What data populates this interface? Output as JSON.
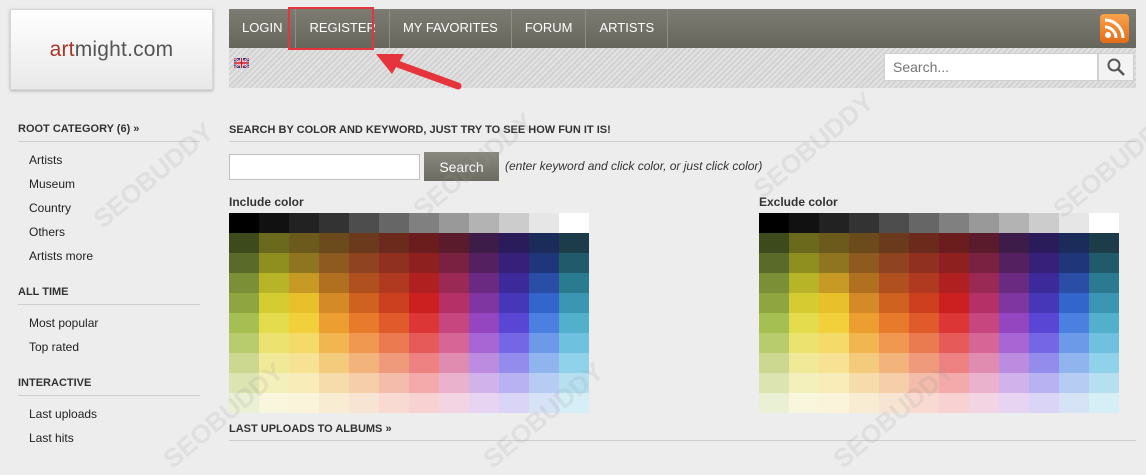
{
  "logo": {
    "part1": "ar",
    "part2": "t",
    "part3": "might.com"
  },
  "nav": {
    "items": [
      "LOGIN",
      "REGISTER",
      "MY FAVORITES",
      "FORUM",
      "ARTISTS"
    ]
  },
  "search": {
    "placeholder": "Search..."
  },
  "sidebar": {
    "sections": [
      {
        "title": "ROOT CATEGORY (6) »",
        "items": [
          "Artists",
          "Museum",
          "Country",
          "Others",
          "Artists more"
        ]
      },
      {
        "title": "ALL TIME",
        "items": [
          "Most popular",
          "Top rated"
        ]
      },
      {
        "title": "INTERACTIVE",
        "items": [
          "Last uploads",
          "Last hits"
        ]
      }
    ]
  },
  "main": {
    "heading": "SEARCH BY COLOR AND KEYWORD, JUST TRY TO SEE HOW FUN IT IS!",
    "search_button": "Search",
    "hint": "(enter keyword and click color, or just click color)",
    "include_label": "Include color",
    "exclude_label": "Exclude color",
    "bottom_heading": "LAST UPLOADS TO ALBUMS »"
  },
  "watermark": "SEOBUDDY",
  "colors": {
    "grays": [
      "#000000",
      "#111111",
      "#222222",
      "#333333",
      "#4d4d4d",
      "#666666",
      "#808080",
      "#999999",
      "#b3b3b3",
      "#cccccc",
      "#e6e6e6",
      "#ffffff"
    ],
    "hues": [
      [
        "#3c4a1c",
        "#6b6a1c",
        "#6b5a1c",
        "#6b4a1c",
        "#6b3a1c",
        "#6b2a1c",
        "#6b1c1c",
        "#5a1c2c",
        "#3e1c4a",
        "#2a1c5a",
        "#1c2c5a",
        "#1c3c4a"
      ],
      [
        "#5a6a28",
        "#8f8f20",
        "#8f7520",
        "#8f5a20",
        "#8f4320",
        "#8f3020",
        "#8f2020",
        "#7a2040",
        "#552060",
        "#36207a",
        "#20367a",
        "#205a6b"
      ],
      [
        "#7a8f36",
        "#b7b428",
        "#c79a26",
        "#b07020",
        "#b05020",
        "#b03a20",
        "#b02020",
        "#9a2a55",
        "#6a2a82",
        "#3c2a9a",
        "#2a4ea6",
        "#2a7a90"
      ],
      [
        "#8fa640",
        "#d4cc30",
        "#e8c02c",
        "#d48a26",
        "#d0621f",
        "#cc4020",
        "#cc2020",
        "#b63068",
        "#7f36a0",
        "#4636b8",
        "#3366cc",
        "#3a96b2"
      ],
      [
        "#a5bf52",
        "#e4dc4c",
        "#f2d03c",
        "#ec9e30",
        "#e87a2c",
        "#e05a2c",
        "#dc3636",
        "#c84680",
        "#9346c0",
        "#5a46d4",
        "#4c80e0",
        "#52b0cc"
      ],
      [
        "#b8cc6e",
        "#ece270",
        "#f4da68",
        "#f2b650",
        "#f09850",
        "#ea7a50",
        "#e65a5a",
        "#d66696",
        "#a866d4",
        "#7466e4",
        "#6c9ae8",
        "#6ec2e0"
      ],
      [
        "#ccd890",
        "#f0ea98",
        "#f6e292",
        "#f4ca7c",
        "#f2b47c",
        "#f09a7c",
        "#ee8282",
        "#e08cb0",
        "#bc8ce0",
        "#948cec",
        "#90b4ee",
        "#90d2ea"
      ],
      [
        "#dce4b2",
        "#f4f0bc",
        "#f8ecb8",
        "#f6dcaa",
        "#f6ceaa",
        "#f4bcaa",
        "#f4aaaa",
        "#eab2cc",
        "#d2b2ea",
        "#b8b2f2",
        "#b6ccf2",
        "#b6e0f0"
      ],
      [
        "#eaf0d4",
        "#f8f6dc",
        "#faf4da",
        "#f8ecd2",
        "#f8e4d2",
        "#f8dad2",
        "#f8d2d2",
        "#f2d4e2",
        "#e6d4f2",
        "#dad4f6",
        "#d6e2f6",
        "#d6eef6"
      ]
    ]
  }
}
